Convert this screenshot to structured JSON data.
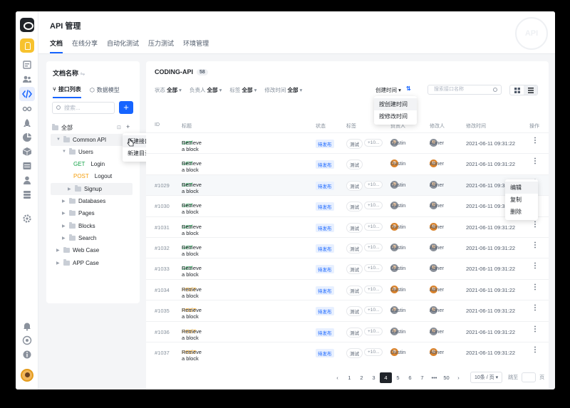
{
  "app": {
    "title": "API 管理",
    "watermark": "API"
  },
  "tabs": [
    "文档",
    "在线分享",
    "自动化测试",
    "压力测试",
    "环境管理"
  ],
  "left_panel": {
    "title": "文档名称",
    "subtabs": [
      "接口列表",
      "数据模型"
    ],
    "search_placeholder": "搜索...",
    "add_label": "+",
    "root_label": "全部",
    "tree": [
      {
        "label": "Common API",
        "type": "folder",
        "level": 1,
        "expanded": true
      },
      {
        "label": "Users",
        "type": "folder",
        "level": 2,
        "expanded": true
      },
      {
        "label": "Login",
        "type": "api",
        "method": "GET",
        "level": 3
      },
      {
        "label": "Logout",
        "type": "api",
        "method": "POST",
        "level": 3
      },
      {
        "label": "Signup",
        "type": "folder",
        "level": 3,
        "expanded": false
      },
      {
        "label": "Databases",
        "type": "folder",
        "level": 2,
        "expanded": false
      },
      {
        "label": "Pages",
        "type": "folder",
        "level": 2,
        "expanded": false
      },
      {
        "label": "Blocks",
        "type": "folder",
        "level": 2,
        "expanded": false
      },
      {
        "label": "Search",
        "type": "folder",
        "level": 2,
        "expanded": false
      },
      {
        "label": "Web Case",
        "type": "folder",
        "level": 1,
        "expanded": false
      },
      {
        "label": "APP Case",
        "type": "folder",
        "level": 1,
        "expanded": false
      }
    ],
    "context_menu": [
      "新建接口",
      "新建目录"
    ]
  },
  "main": {
    "title": "CODING-API",
    "count": "58",
    "filters": [
      {
        "label": "状态",
        "value": "全部"
      },
      {
        "label": "负责人",
        "value": "全部"
      },
      {
        "label": "标签",
        "value": "全部"
      },
      {
        "label": "修改时间",
        "value": "全部"
      }
    ],
    "sort_label": "创建时间",
    "sort_options": [
      "按创建时间",
      "按修改时间"
    ],
    "search_placeholder": "搜索接口名称",
    "columns": [
      "ID",
      "标题",
      "状态",
      "标签",
      "负责人",
      "修改人",
      "修改时间",
      "操作"
    ],
    "rows": [
      {
        "id": "",
        "method": "GET",
        "title": "Retrieve a block",
        "status": "待发布",
        "tag": "测试",
        "more": "+10...",
        "owner": "Dustin",
        "modifier": "Abner",
        "time": "2021-06-11  09:31:22"
      },
      {
        "id": "",
        "method": "GET",
        "title": "Retrieve a block",
        "status": "待发布",
        "tag": "测试",
        "more": "",
        "owner": "Dustin",
        "modifier": "Abner",
        "time": "2021-06-11  09:31:22"
      },
      {
        "id": "#1029",
        "method": "GET",
        "title": "Retrieve a block",
        "status": "待发布",
        "tag": "测试",
        "more": "+10...",
        "owner": "Dustin",
        "modifier": "Abner",
        "time": "2021-06-11  09:31:22"
      },
      {
        "id": "#1030",
        "method": "GET",
        "title": "Retrieve a block",
        "status": "待发布",
        "tag": "测试",
        "more": "+10...",
        "owner": "Dustin",
        "modifier": "Abner",
        "time": "2021-06-11  09:31:22"
      },
      {
        "id": "#1031",
        "method": "GET",
        "title": "Retrieve a block",
        "status": "待发布",
        "tag": "测试",
        "more": "+10...",
        "owner": "Dustin",
        "modifier": "Abner",
        "time": "2021-06-11  09:31:22"
      },
      {
        "id": "#1032",
        "method": "GET",
        "title": "Retrieve a block",
        "status": "待发布",
        "tag": "测试",
        "more": "+10...",
        "owner": "Dustin",
        "modifier": "Abner",
        "time": "2021-06-11  09:31:22"
      },
      {
        "id": "#1033",
        "method": "GET",
        "title": "Retrieve a block",
        "status": "待发布",
        "tag": "测试",
        "more": "+10...",
        "owner": "Dustin",
        "modifier": "Abner",
        "time": "2021-06-11  09:31:22"
      },
      {
        "id": "#1034",
        "method": "POST",
        "title": "Retrieve a block",
        "status": "待发布",
        "tag": "测试",
        "more": "+10...",
        "owner": "Dustin",
        "modifier": "Abner",
        "time": "2021-06-11  09:31:22"
      },
      {
        "id": "#1035",
        "method": "POST",
        "title": "Retrieve a block",
        "status": "待发布",
        "tag": "测试",
        "more": "+10...",
        "owner": "Dustin",
        "modifier": "Abner",
        "time": "2021-06-11  09:31:22"
      },
      {
        "id": "#1036",
        "method": "POST",
        "title": "Retrieve a block",
        "status": "待发布",
        "tag": "测试",
        "more": "+10...",
        "owner": "Dustin",
        "modifier": "Abner",
        "time": "2021-06-11  09:31:22"
      },
      {
        "id": "#1037",
        "method": "POST",
        "title": "Retrieve a block",
        "status": "待发布",
        "tag": "测试",
        "more": "+10...",
        "owner": "Dustin",
        "modifier": "Abner",
        "time": "2021-06-11  09:31:22"
      }
    ],
    "row_menu": [
      "编辑",
      "复制",
      "删除"
    ],
    "pagination": {
      "prev": "‹",
      "next": "›",
      "pages": [
        "1",
        "2",
        "3",
        "4",
        "5",
        "6",
        "7",
        "•••",
        "50"
      ],
      "current": "4",
      "page_size": "10条 / 页",
      "jump_label": "跳至",
      "jump_suffix": "页"
    }
  },
  "colors": {
    "accent": "#1664ff",
    "get": "#16a34a",
    "post": "#f59e0b",
    "status_bg": "#e8f0ff"
  },
  "icons": [
    "logo-icon",
    "project-icon",
    "dashboard-icon",
    "team-icon",
    "api-icon",
    "infinity-icon",
    "rocket-icon",
    "chart-icon",
    "box-icon",
    "table-icon",
    "person-icon",
    "stack-icon",
    "settings-icon",
    "bell-icon",
    "help-icon",
    "info-icon"
  ]
}
